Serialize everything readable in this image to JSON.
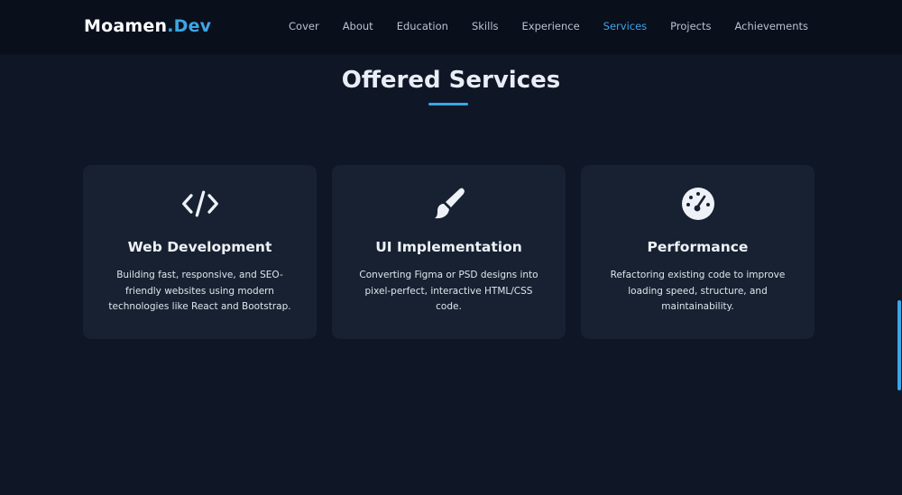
{
  "brand": {
    "name_part1": "Moamen",
    "name_part2": ".Dev"
  },
  "nav": {
    "items": [
      {
        "label": "Cover"
      },
      {
        "label": "About"
      },
      {
        "label": "Education"
      },
      {
        "label": "Skills"
      },
      {
        "label": "Experience"
      },
      {
        "label": "Services",
        "active": true
      },
      {
        "label": "Projects"
      },
      {
        "label": "Achievements"
      }
    ]
  },
  "section": {
    "title": "Offered Services"
  },
  "services": [
    {
      "icon": "code-icon",
      "title": "Web Development",
      "description": "Building fast, responsive, and SEO-friendly websites using modern technologies like React and Bootstrap."
    },
    {
      "icon": "paintbrush-icon",
      "title": "UI Implementation",
      "description": "Converting Figma or PSD designs into pixel-perfect, interactive HTML/CSS code."
    },
    {
      "icon": "gauge-icon",
      "title": "Performance",
      "description": "Refactoring existing code to improve loading speed, structure, and maintainability."
    }
  ],
  "colors": {
    "accent": "#3aa6e8",
    "background": "#0f1626",
    "card": "#172131",
    "navbar": "#0a0f1c"
  }
}
